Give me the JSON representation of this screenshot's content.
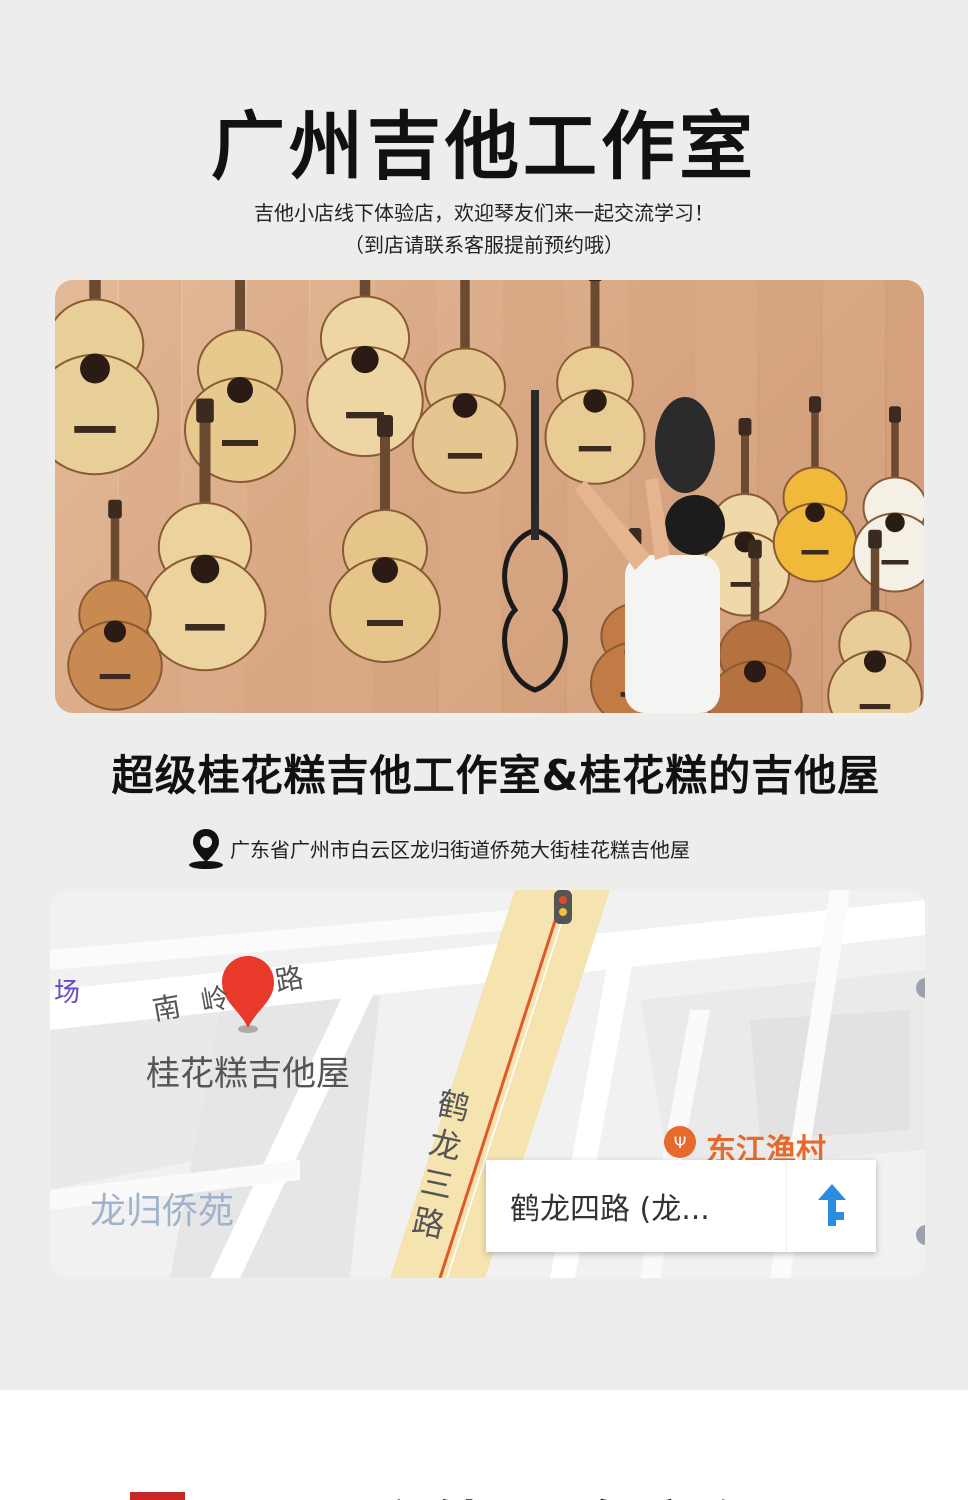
{
  "header": {
    "title": "广州吉他工作室",
    "subtitle_line1": "吉他小店线下体验店，欢迎琴友们来一起交流学习！",
    "subtitle_line2": "（到店请联系客服提前预约哦）"
  },
  "studio": {
    "name": "超级桂花糕吉他工作室&桂花糕的吉他屋",
    "address": "广东省广州市白云区龙归街道侨苑大街桂花糕吉他屋",
    "location_icon": "location-pin-icon"
  },
  "map": {
    "marker_label": "桂花糕吉他屋",
    "road_nanling": "南岭路",
    "road_nanling_part1": "南 岭",
    "road_nanling_part2": "路",
    "road_helong3": "鹤龙三路",
    "district": "龙归侨苑",
    "poi_restaurant": "东江渔村",
    "edge_label": "场",
    "nav_card_road": "鹤龙四路 (龙...",
    "nav_icon": "navigation-arrow-icon",
    "colors": {
      "marker": "#e8392b",
      "main_road": "#f5e3b0",
      "road_red_line": "#e0592a",
      "nav_blue": "#2a8de0",
      "poi_orange": "#e66a2c"
    }
  },
  "footer": {
    "partial_heading": "弦外颈临窗佩",
    "accent_color": "#c62828"
  }
}
